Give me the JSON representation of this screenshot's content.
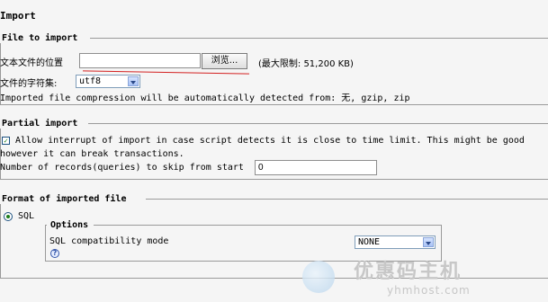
{
  "page_heading": "Import",
  "file_section": {
    "legend": "File to import",
    "file_label": "文本文件的位置",
    "file_value": "",
    "browse_label": "浏览...",
    "max_size": "(最大限制: 51,200 KB)",
    "charset_label": "文件的字符集:",
    "charset_value": "utf8",
    "compression_note": "Imported file compression will be automatically detected from: 无, gzip, zip"
  },
  "partial_section": {
    "legend": "Partial import",
    "interrupt_checked": true,
    "interrupt_label_line1": "Allow interrupt of import in case script detects it is close to time limit. This might be good",
    "interrupt_label_line2": "however it can break transactions.",
    "skip_label": "Number of records(queries) to skip from start",
    "skip_value": "0"
  },
  "format_section": {
    "legend": "Format of imported file",
    "format_option": "SQL",
    "format_selected": true,
    "options_legend": "Options",
    "compat_label": "SQL compatibility mode",
    "compat_value": "NONE",
    "help_glyph": "?"
  },
  "watermark": {
    "text_cn": "优惠码主机",
    "text_en": "yhmhost.com"
  }
}
